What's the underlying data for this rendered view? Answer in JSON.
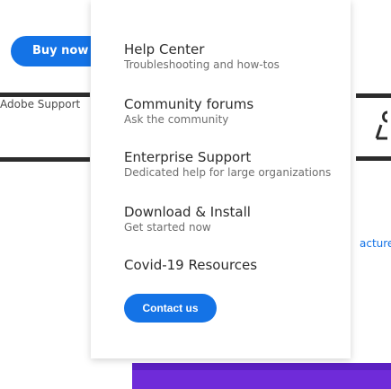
{
  "background": {
    "buy_now_label": "Buy now",
    "support_label": "Adobe Support",
    "right_link_text": "acturer"
  },
  "menu": {
    "items": [
      {
        "title": "Help Center",
        "subtitle": "Troubleshooting and how-tos"
      },
      {
        "title": "Community forums",
        "subtitle": "Ask the community"
      },
      {
        "title": "Enterprise Support",
        "subtitle": "Dedicated help for large organizations"
      },
      {
        "title": "Download & Install",
        "subtitle": "Get started now"
      },
      {
        "title": "Covid-19 Resources",
        "subtitle": ""
      }
    ],
    "contact_label": "Contact us"
  },
  "colors": {
    "accent_blue": "#1473e6",
    "bottom_band": "#6f2bd9"
  },
  "icons": {
    "right_icon": "wrench-icon"
  }
}
